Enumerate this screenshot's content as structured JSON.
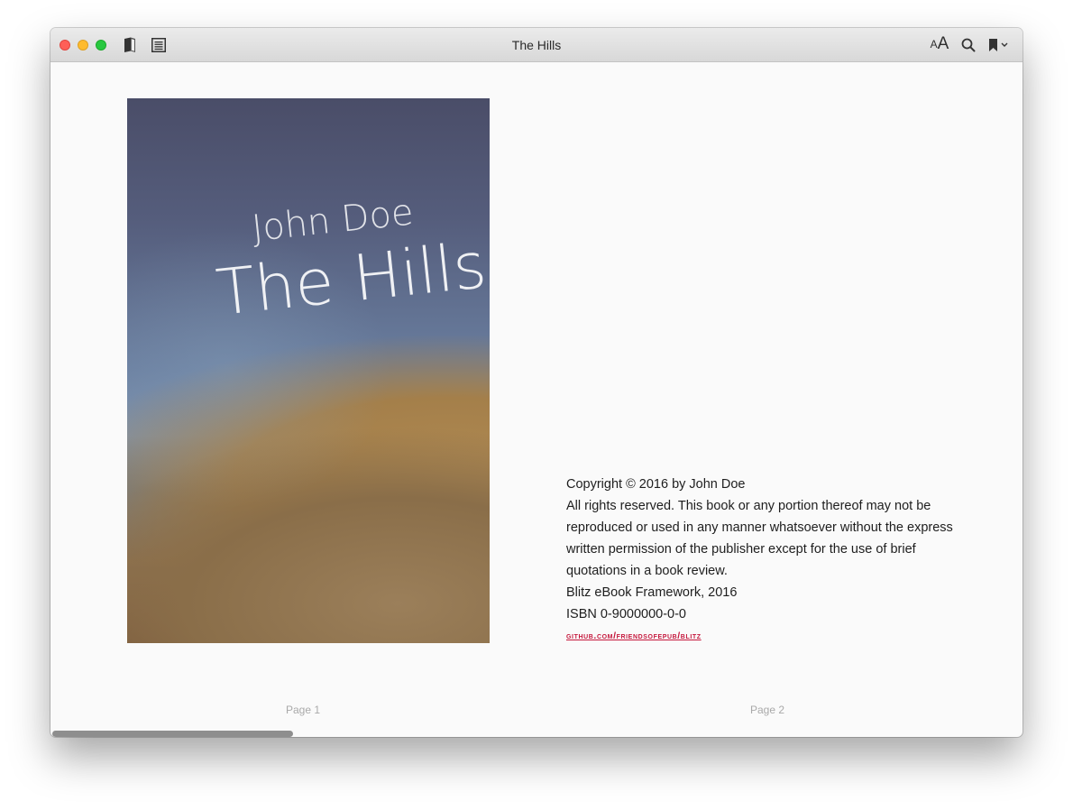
{
  "window": {
    "title": "The Hills"
  },
  "toolbar": {
    "library_icon": "book-icon",
    "toc_icon": "list-icon",
    "font_size_small": "A",
    "font_size_large": "A",
    "search_icon": "search-icon",
    "bookmark_icon": "bookmark-icon",
    "bookmark_menu_icon": "chevron-down-icon"
  },
  "cover": {
    "author": "John Doe",
    "title": "The Hills"
  },
  "copyright_page": {
    "lines": [
      "Copyright © 2016 by John Doe",
      "All rights reserved. This book or any portion thereof may not be",
      "reproduced or used in any manner whatsoever without the express",
      "written permission of the publisher except for the use of brief",
      "quotations in a book review.",
      "Blitz eBook Framework, 2016",
      "ISBN 0-9000000-0-0"
    ],
    "link": "github.com/friendsofepub/blitz"
  },
  "pages": {
    "left_label": "Page 1",
    "right_label": "Page 2"
  },
  "scroll": {
    "horizontal_position": 0.0
  }
}
